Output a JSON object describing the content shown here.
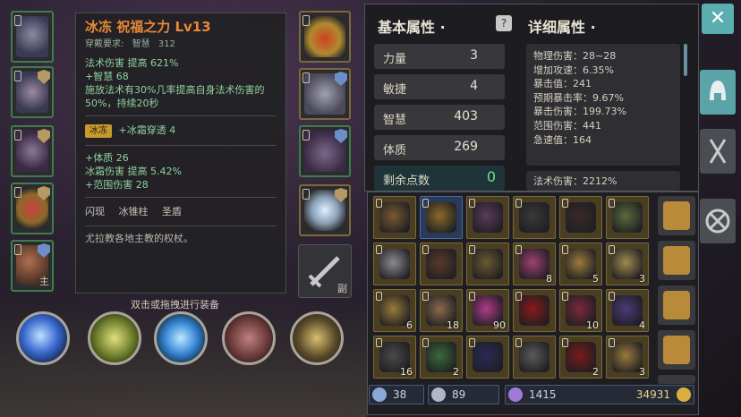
{
  "equip_slots_left": [
    {
      "name": "helmet",
      "label": ""
    },
    {
      "name": "armor",
      "label": ""
    },
    {
      "name": "cape",
      "label": ""
    },
    {
      "name": "amulet",
      "label": ""
    },
    {
      "name": "weapon-main",
      "label": "主"
    }
  ],
  "equip_slots_right": [
    {
      "name": "necklace",
      "label": ""
    },
    {
      "name": "gloves",
      "label": ""
    },
    {
      "name": "boots",
      "label": ""
    },
    {
      "name": "ring",
      "label": ""
    },
    {
      "name": "offhand",
      "label": "副"
    }
  ],
  "tooltip": {
    "title": "冰冻 祝福之力 Lv13",
    "req_label": "穿戴要求:",
    "req_stat": "智慧",
    "req_value": "312",
    "line1": "法术伤害 提高 621%",
    "line2": "+智慧 68",
    "line3": "施放法术有30%几率提高自身法术伤害的50%，持续20秒",
    "tag": "冰冻",
    "tag_effect": "+冰霜穿透 4",
    "line4": "+体质 26",
    "line5": "冰霜伤害 提高 5.42%",
    "line6": "+范围伤害 28",
    "skills": [
      "闪现",
      "冰锥柱",
      "圣盾"
    ],
    "flavor": "尤拉教各地主教的权杖。"
  },
  "hint": "双击或拖拽进行装备",
  "basic": {
    "title": "基本属性 ·",
    "help_icon": "?",
    "stats": [
      {
        "k": "力量",
        "v": "3"
      },
      {
        "k": "敏捷",
        "v": "4"
      },
      {
        "k": "智慧",
        "v": "403"
      },
      {
        "k": "体质",
        "v": "269"
      }
    ],
    "free_label": "剩余点数",
    "free_value": "0"
  },
  "detail": {
    "title": "详细属性 ·",
    "lines": [
      "物理伤害：28~28",
      "增加攻速：6.35%",
      "暴击值：241",
      "预期暴击率：9.67%",
      "暴击伤害：199.73%",
      "范围伤害：441",
      "急速值：164"
    ],
    "extra": "法术伤害：2212%"
  },
  "close_label": "✕",
  "inventory": [
    [
      {
        "c": "#7a5a30",
        "n": ""
      },
      {
        "c": "#8a6a2a",
        "n": "",
        "blue": true
      },
      {
        "c": "#5a3a5a",
        "n": ""
      },
      {
        "c": "#3a3a3a",
        "n": ""
      },
      {
        "c": "#3a2a2a",
        "n": ""
      },
      {
        "c": "#5a6a3a",
        "n": ""
      }
    ],
    [
      {
        "c": "#8a8a90",
        "n": ""
      },
      {
        "c": "#5a3a2a",
        "n": ""
      },
      {
        "c": "#6a5a30",
        "n": ""
      },
      {
        "c": "#a04070",
        "n": "8"
      },
      {
        "c": "#9a7a3a",
        "n": "5"
      },
      {
        "c": "#a08a50",
        "n": "3"
      }
    ],
    [
      {
        "c": "#9a7a3a",
        "n": "6"
      },
      {
        "c": "#8a6a4a",
        "n": "18"
      },
      {
        "c": "#b03a8a",
        "n": "90"
      },
      {
        "c": "#8a1a1a",
        "n": ""
      },
      {
        "c": "#7a2a3a",
        "n": "10"
      },
      {
        "c": "#4a3a7a",
        "n": "4"
      }
    ],
    [
      {
        "c": "#4a4a4a",
        "n": "16"
      },
      {
        "c": "#3a6a3a",
        "n": "2"
      },
      {
        "c": "#2a2a5a",
        "n": ""
      },
      {
        "c": "#5a5a5a",
        "n": ""
      },
      {
        "c": "#7a1a1a",
        "n": "2"
      },
      {
        "c": "#9a7a3a",
        "n": "3"
      }
    ]
  ],
  "footer": {
    "attack": "38",
    "pets": "89",
    "gems": "1415",
    "gold": "34931"
  }
}
